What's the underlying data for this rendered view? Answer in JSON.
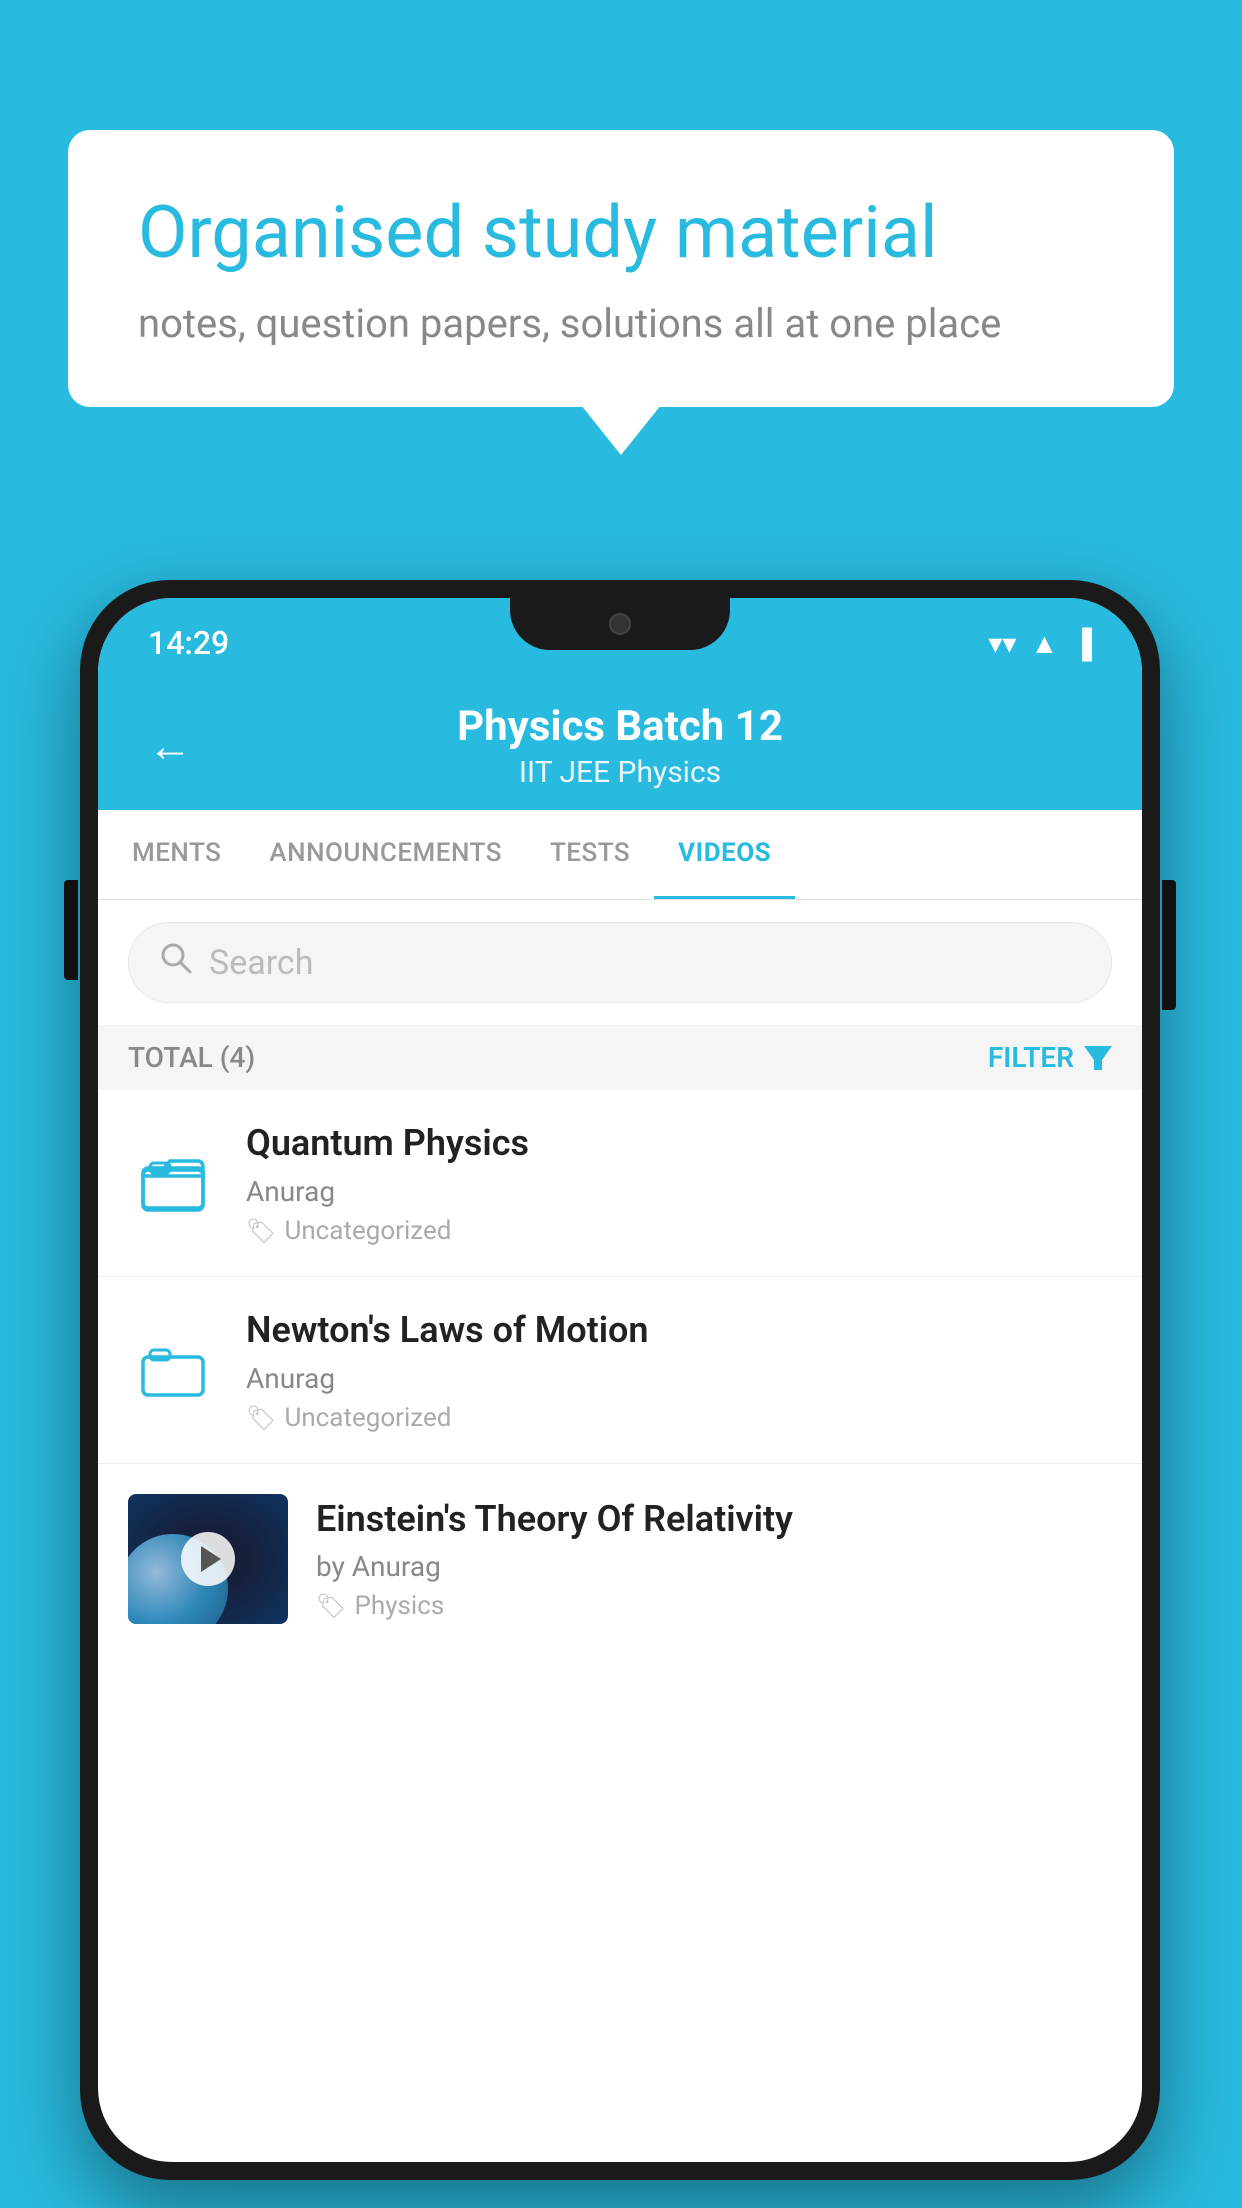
{
  "background_color": "#29BADF",
  "speech_bubble": {
    "title": "Organised study material",
    "subtitle": "notes, question papers, solutions all at one place"
  },
  "status_bar": {
    "time": "14:29",
    "wifi": "▼",
    "signal": "▲",
    "battery": "▌"
  },
  "header": {
    "back_label": "←",
    "title": "Physics Batch 12",
    "subtitle": "IIT JEE   Physics"
  },
  "tabs": [
    {
      "label": "MENTS",
      "active": false
    },
    {
      "label": "ANNOUNCEMENTS",
      "active": false
    },
    {
      "label": "TESTS",
      "active": false
    },
    {
      "label": "VIDEOS",
      "active": true
    }
  ],
  "search": {
    "placeholder": "Search"
  },
  "filter": {
    "total_label": "TOTAL (4)",
    "filter_label": "FILTER"
  },
  "videos": [
    {
      "id": 1,
      "title": "Quantum Physics",
      "author": "Anurag",
      "tag": "Uncategorized",
      "has_thumb": false
    },
    {
      "id": 2,
      "title": "Newton's Laws of Motion",
      "author": "Anurag",
      "tag": "Uncategorized",
      "has_thumb": false
    },
    {
      "id": 3,
      "title": "Einstein's Theory Of Relativity",
      "author": "by Anurag",
      "tag": "Physics",
      "has_thumb": true
    }
  ]
}
